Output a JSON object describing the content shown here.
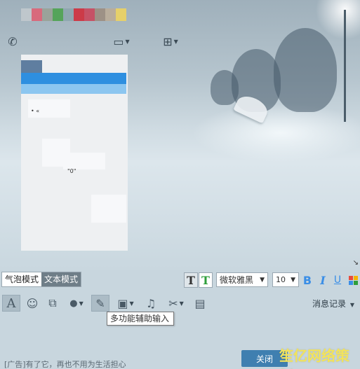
{
  "mode_toggle": {
    "bubble_mode": "气泡模式",
    "text_mode": "文本模式"
  },
  "format_bar": {
    "font_name": "微软雅黑",
    "font_size": "10",
    "bold_label": "B",
    "italic_label": "I",
    "underline_label": "U",
    "text_style_label": "T",
    "text_color_label": "T"
  },
  "tools": {
    "items": [
      {
        "name": "font-icon",
        "glyph": "A"
      },
      {
        "name": "emoji-icon",
        "glyph": "☺"
      },
      {
        "name": "screenshot-icon",
        "glyph": "⧉"
      },
      {
        "name": "voice-icon",
        "glyph": "🎤"
      },
      {
        "name": "pen-icon",
        "glyph": "✎"
      },
      {
        "name": "image-icon",
        "glyph": "▣"
      },
      {
        "name": "music-icon",
        "glyph": "♫"
      },
      {
        "name": "scissors-icon",
        "glyph": "✂"
      },
      {
        "name": "trash-icon",
        "glyph": "▤"
      }
    ],
    "history_label": "消息记录"
  },
  "tooltip": {
    "text": "多功能辅助输入"
  },
  "footer": {
    "ad_text": "[广告]有了它，再也不用为生活担心",
    "close_label": "关闭",
    "watermark": "笙亿网络策划"
  },
  "chat_panel": {
    "line1": "• «",
    "line2": "\"0\""
  },
  "colors": {
    "accent_blue": "#2e8fe0",
    "format_blue": "#3a8ee6",
    "text_color_green": "#2e9e3b"
  }
}
